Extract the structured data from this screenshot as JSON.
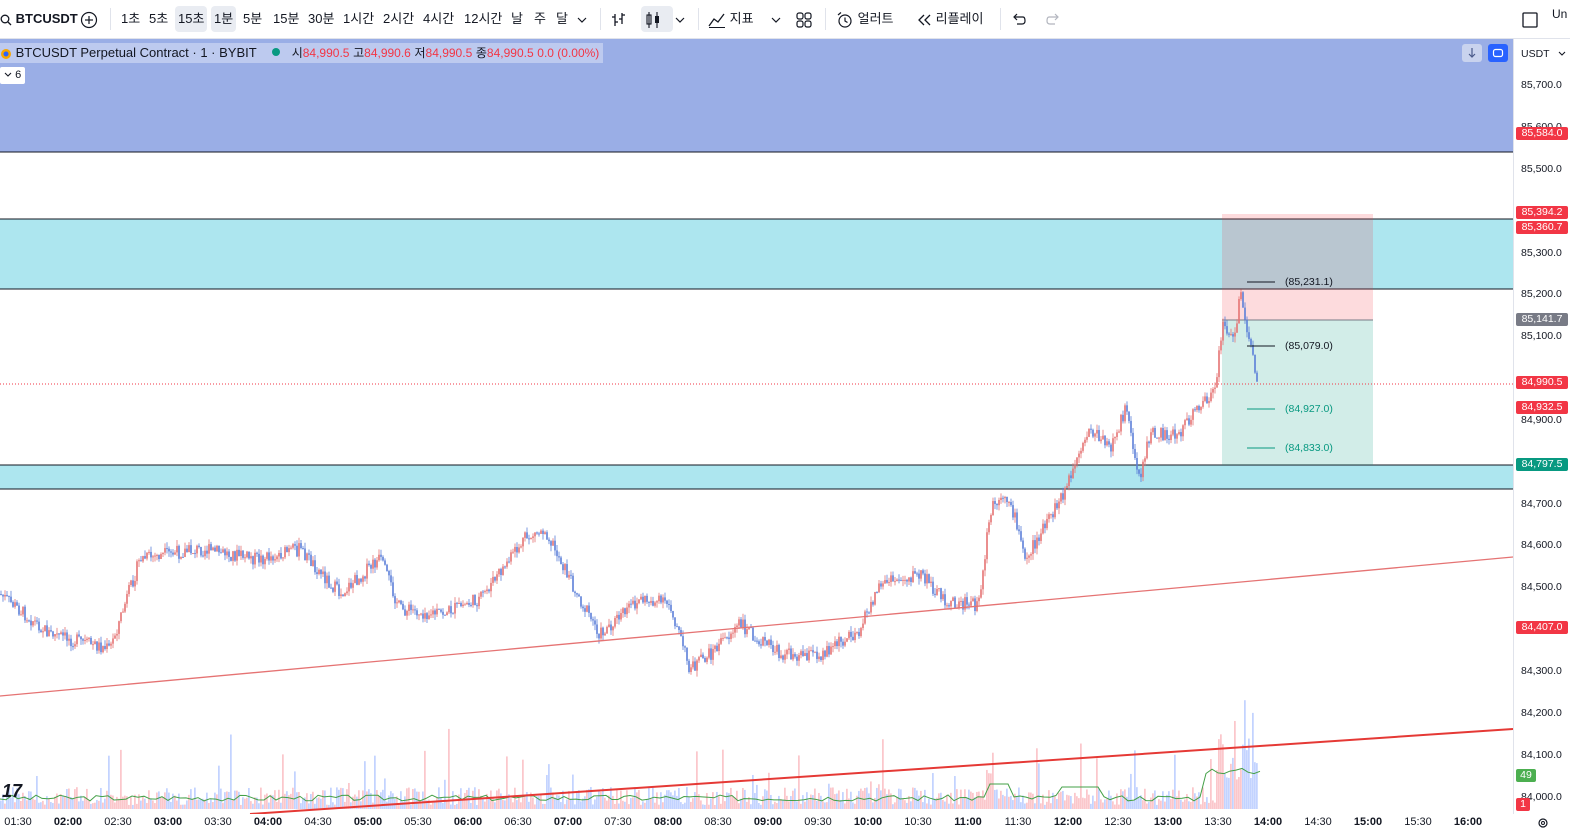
{
  "toolbar": {
    "symbol": "BTCUSDT",
    "intervals": [
      "1초",
      "5초",
      "15초",
      "1분",
      "5분",
      "15분",
      "30분",
      "1시간",
      "2시간",
      "4시간",
      "12시간",
      "날",
      "주",
      "달"
    ],
    "active_intervals": [
      "15초",
      "1분"
    ],
    "indicators_label": "지표",
    "alert_label": "얼러트",
    "replay_label": "리플레이",
    "right_text": "Un"
  },
  "legend": {
    "title": "BTCUSDT Perpetual Contract · 1 · BYBIT",
    "open_label": "시",
    "open": "84,990.5",
    "high_label": "고",
    "high": "84,990.6",
    "low_label": "저",
    "low": "84,990.5",
    "close_label": "종",
    "close": "84,990.5",
    "change": "0.0 (0.00%)",
    "collapsed_count": "6"
  },
  "price_axis": {
    "currency": "USDT",
    "labels": [
      "85,700.0",
      "85,600.0",
      "85,500.0",
      "85,300.0",
      "85,200.0",
      "85,100.0",
      "84,900.0",
      "84,700.0",
      "84,600.0",
      "84,500.0",
      "84,300.0",
      "84,200.0",
      "84,100.0",
      "84,000.0"
    ],
    "tags": [
      {
        "text": "85,584.0",
        "color": "#f23645"
      },
      {
        "text": "85,394.2",
        "color": "#f23645"
      },
      {
        "text": "85,360.7",
        "color": "#f23645"
      },
      {
        "text": "85,141.7",
        "color": "#787b86"
      },
      {
        "text": "84,990.5",
        "color": "#f23645"
      },
      {
        "text": "84,932.5",
        "color": "#f23645"
      },
      {
        "text": "84,797.5",
        "color": "#089981"
      },
      {
        "text": "84,407.0",
        "color": "#f23645"
      },
      {
        "text": "49",
        "color": "#4caf50"
      },
      {
        "text": "1",
        "color": "#f23645"
      }
    ]
  },
  "time_axis": {
    "labels": [
      "01:30",
      "02:00",
      "02:30",
      "03:00",
      "03:30",
      "04:00",
      "04:30",
      "05:00",
      "05:30",
      "06:00",
      "06:30",
      "07:00",
      "07:30",
      "08:00",
      "08:30",
      "09:00",
      "09:30",
      "10:00",
      "10:30",
      "11:00",
      "11:30",
      "12:00",
      "12:30",
      "13:00",
      "13:30",
      "14:00",
      "14:30",
      "15:00",
      "15:30",
      "16:00"
    ]
  },
  "position_tool": {
    "levels": [
      "(85,231.1)",
      "(85,079.0)",
      "(84,927.0)",
      "(84,833.0)"
    ]
  },
  "colors": {
    "up": "#089981",
    "down": "#f23645",
    "candle_up": "#e57373",
    "candle_down": "#5b7fd8",
    "zone_blue": "#9aaee6",
    "zone_cyan": "#ade6ef",
    "trendline": "#e53935"
  },
  "logo_text": "17"
}
